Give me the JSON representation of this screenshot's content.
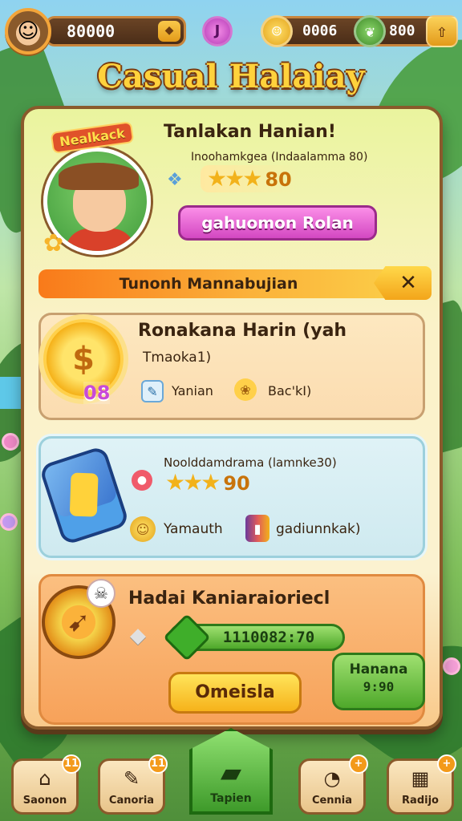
{
  "hud": {
    "coins": "80000",
    "coin_plus": "◆",
    "gem_letter": "J",
    "res1": "0006",
    "res2": "800",
    "res_plus": "⇧"
  },
  "title": "Casual Halaiay",
  "profile": {
    "badge": "Nealkack",
    "name": "Tanlakan Hanian!",
    "subtitle": "Inoohamkgea (Indaalamma 80)",
    "stars": "★★★",
    "stars_value": "80",
    "button_label": "gahuomon Rolan"
  },
  "banner": {
    "text": "Tunonh Mannabujian",
    "close_label": "✕"
  },
  "card1": {
    "title": "Ronakana Harin (yah",
    "subtitle": "Tmaoka1)",
    "badge": "08",
    "item1": "Yanian",
    "item2": "Bac'kI)"
  },
  "card2": {
    "subtitle": "Noolddamdrama (lamnke30)",
    "stars": "★★★",
    "stars_value": "90",
    "item1": "Yamauth",
    "item2": "gadiunnkak)"
  },
  "card3": {
    "title": "Hadai Kaniaraioriecl",
    "progress_text": "1110082:70",
    "button_label": "Omeisla",
    "side_label": "Hanana",
    "side_value": "9:90"
  },
  "nav": {
    "items": [
      {
        "label": "Saonon",
        "icon": "⌂",
        "badge": "11"
      },
      {
        "label": "Canoria",
        "icon": "✎",
        "badge": "11"
      },
      {
        "label": "Tapien",
        "icon": "▰"
      },
      {
        "label": "Cennia",
        "icon": "◔",
        "badge": "+"
      },
      {
        "label": "Radijo",
        "icon": "▦",
        "badge": "+"
      }
    ]
  },
  "colors": {
    "title_gold": "#ffd23c",
    "panel_border": "#8a5a2b",
    "pink_button": "#d348c2",
    "green_accent": "#4ea82a",
    "orange_banner": "#f97a1a"
  }
}
